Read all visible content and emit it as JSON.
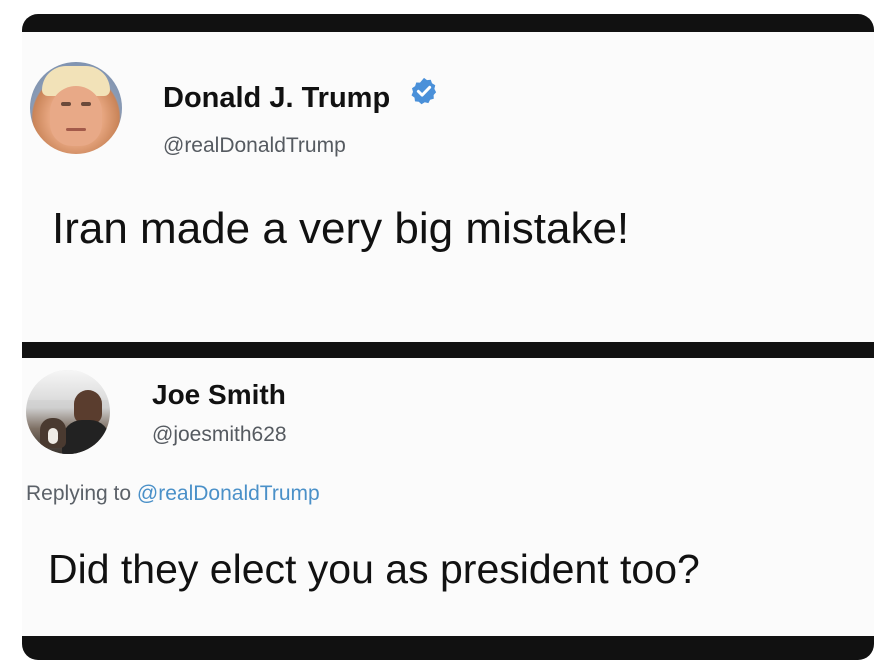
{
  "top_tweet": {
    "display_name": "Donald J. Trump",
    "handle": "@realDonaldTrump",
    "verified": true,
    "text": "Iran made a very big mistake!"
  },
  "reply_tweet": {
    "display_name": "Joe Smith",
    "handle": "@joesmith628",
    "replying_prefix": "Replying to",
    "replying_to": "@realDonaldTrump",
    "text": "Did they elect you as president too?"
  },
  "colors": {
    "verified_badge": "#4a90d9",
    "mention": "#4a90c8",
    "frame": "#111111"
  },
  "icons": {
    "verified": "verified-badge-icon"
  }
}
